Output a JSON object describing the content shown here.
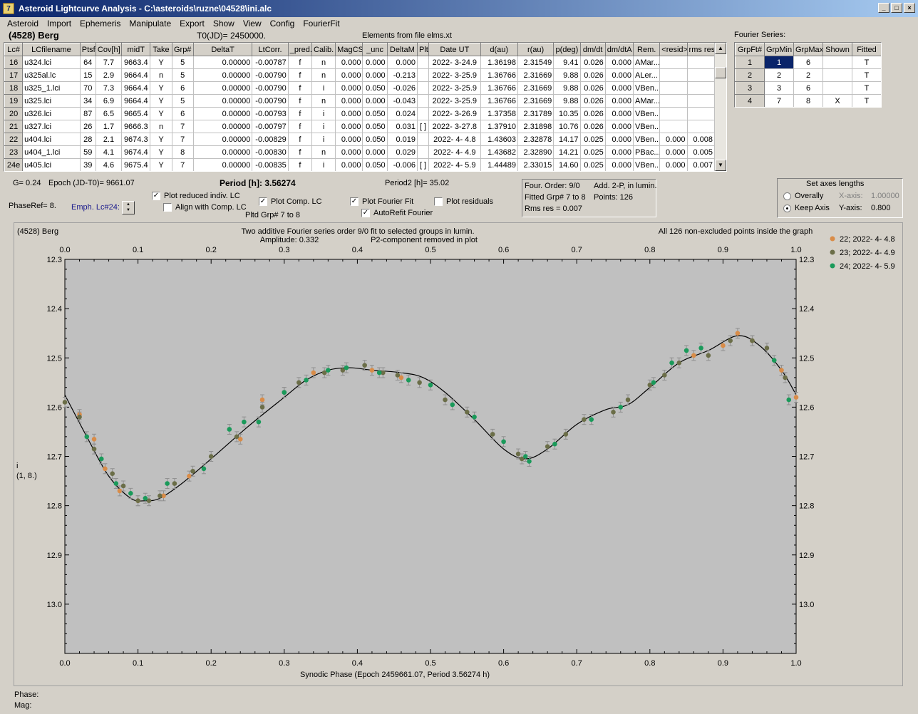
{
  "window": {
    "title": "Asteroid Lightcurve Analysis - C:\\asteroids\\ruzne\\04528\\ini.alc",
    "icon": "app-icon",
    "min": "_",
    "max": "□",
    "close": "×"
  },
  "menu": [
    "Asteroid",
    "Import",
    "Ephemeris",
    "Manipulate",
    "Export",
    "Show",
    "View",
    "Config",
    "FourierFit"
  ],
  "header": {
    "asteroid": "(4528) Berg",
    "t0": "T0(JD)= 2450000.",
    "elements": "Elements from file elms.xt"
  },
  "table": {
    "columns": [
      "Lc#",
      "LCfilename",
      "Ptsf",
      "Cov[h]",
      "midT",
      "Take",
      "Grp#",
      "DeltaT",
      "LtCorr.",
      "_pred.",
      "Calib.",
      "MagCS",
      "_unc",
      "DeltaM",
      "Plt",
      "Date UT",
      "d(au)",
      "r(au)",
      "p(deg)",
      "dm/dt",
      "dm/dtA",
      "Rem.",
      "<resid>",
      "rms res"
    ],
    "rows": [
      [
        "16",
        "u324.lci",
        "64",
        "7.7",
        "9663.4",
        "Y",
        "5",
        "0.00000",
        "-0.00787",
        "f",
        "n",
        "0.000",
        "0.000",
        "0.000",
        "",
        "2022- 3-24.9",
        "1.36198",
        "2.31549",
        "9.41",
        "0.026",
        "0.000",
        "AMar...",
        "",
        ""
      ],
      [
        "17",
        "u325al.lc",
        "15",
        "2.9",
        "9664.4",
        "n",
        "5",
        "0.00000",
        "-0.00790",
        "f",
        "n",
        "0.000",
        "0.000",
        "-0.213",
        "",
        "2022- 3-25.9",
        "1.36766",
        "2.31669",
        "9.88",
        "0.026",
        "0.000",
        "ALer...",
        "",
        ""
      ],
      [
        "18",
        "u325_1.lci",
        "70",
        "7.3",
        "9664.4",
        "Y",
        "6",
        "0.00000",
        "-0.00790",
        "f",
        "i",
        "0.000",
        "0.050",
        "-0.026",
        "",
        "2022- 3-25.9",
        "1.36766",
        "2.31669",
        "9.88",
        "0.026",
        "0.000",
        "VBen...",
        "",
        ""
      ],
      [
        "19",
        "u325.lci",
        "34",
        "6.9",
        "9664.4",
        "Y",
        "5",
        "0.00000",
        "-0.00790",
        "f",
        "n",
        "0.000",
        "0.000",
        "-0.043",
        "",
        "2022- 3-25.9",
        "1.36766",
        "2.31669",
        "9.88",
        "0.026",
        "0.000",
        "AMar...",
        "",
        ""
      ],
      [
        "20",
        "u326.lci",
        "87",
        "6.5",
        "9665.4",
        "Y",
        "6",
        "0.00000",
        "-0.00793",
        "f",
        "i",
        "0.000",
        "0.050",
        "0.024",
        "",
        "2022- 3-26.9",
        "1.37358",
        "2.31789",
        "10.35",
        "0.026",
        "0.000",
        "VBen...",
        "",
        ""
      ],
      [
        "21",
        "u327.lci",
        "26",
        "1.7",
        "9666.3",
        "n",
        "7",
        "0.00000",
        "-0.00797",
        "f",
        "i",
        "0.000",
        "0.050",
        "0.031",
        "[ ]",
        "2022- 3-27.8",
        "1.37910",
        "2.31898",
        "10.76",
        "0.026",
        "0.000",
        "VBen...",
        "",
        ""
      ],
      [
        "22",
        "u404.lci",
        "28",
        "2.1",
        "9674.3",
        "Y",
        "7",
        "0.00000",
        "-0.00829",
        "f",
        "i",
        "0.000",
        "0.050",
        "0.019",
        "",
        "2022- 4- 4.8",
        "1.43603",
        "2.32878",
        "14.17",
        "0.025",
        "0.000",
        "VBen...",
        "0.000",
        "0.008"
      ],
      [
        "23",
        "u404_1.lci",
        "59",
        "4.1",
        "9674.4",
        "Y",
        "8",
        "0.00000",
        "-0.00830",
        "f",
        "n",
        "0.000",
        "0.000",
        "0.029",
        "",
        "2022- 4- 4.9",
        "1.43682",
        "2.32890",
        "14.21",
        "0.025",
        "0.000",
        "PBac...",
        "0.000",
        "0.005"
      ],
      [
        "24e",
        "u405.lci",
        "39",
        "4.6",
        "9675.4",
        "Y",
        "7",
        "0.00000",
        "-0.00835",
        "f",
        "i",
        "0.000",
        "0.050",
        "-0.006",
        "[ ]",
        "2022- 4- 5.9",
        "1.44489",
        "2.33015",
        "14.60",
        "0.025",
        "0.000",
        "VBen...",
        "0.000",
        "0.007"
      ]
    ]
  },
  "fourier": {
    "title": "Fourier Series:",
    "columns": [
      "GrpFt#",
      "GrpMin",
      "GrpMax",
      "Shown",
      "Fitted"
    ],
    "rows": [
      [
        "1",
        "1",
        "6",
        "",
        "T"
      ],
      [
        "2",
        "2",
        "2",
        "",
        "T"
      ],
      [
        "3",
        "3",
        "6",
        "",
        "T"
      ],
      [
        "4",
        "7",
        "8",
        "X",
        "T"
      ]
    ]
  },
  "info": {
    "g": "G= 0.24",
    "epoch": "Epoch (JD-T0)= 9661.07",
    "period": "Period [h]: 3.56274",
    "period2": "Period2 [h]= 35.02",
    "phaseref": "PhaseRef= 8.",
    "emph": "Emph. Lc#24:"
  },
  "checks": {
    "reduced": "Plot reduced indiv. LC",
    "align": "Align with Comp. LC",
    "comp": "Plot Comp. LC",
    "pltd": "Pltd Grp#  7  to   8",
    "fourier": "Plot Fourier Fit",
    "autorefit": "AutoRefit Fourier",
    "residuals": "Plot residuals"
  },
  "fitbox": {
    "order": "Four. Order:  9/0",
    "add": "Add. 2-P, in lumin.",
    "fitted": "Fitted Grp# 7 to 8",
    "points": "Points: 126",
    "rms": "Rms res      = 0.007"
  },
  "axes": {
    "title": "Set axes lengths",
    "overally": "Overally",
    "keep": "Keep Axis",
    "xaxis": "X-axis:",
    "xval": "1.00000",
    "yaxis": "Y-axis:",
    "yval": "0.800"
  },
  "chart_data": {
    "type": "scatter",
    "object": "(4528) Berg",
    "title": "Two additive Fourier series order 9/0 fit to selected groups in lumin.",
    "subtitle": "Amplitude: 0.332",
    "note2": "P2-component removed in plot",
    "note3": "All 126 non-excluded points inside the graph",
    "xlabel": "Synodic Phase (Epoch 2459661.07, Period 3.56274 h)",
    "ylabel": "i",
    "ylabel2": "(1, 8.)",
    "xlim": [
      0,
      1
    ],
    "ylim": [
      12.3,
      13.1
    ],
    "xticks": [
      "0.0",
      "0.1",
      "0.2",
      "0.3",
      "0.4",
      "0.5",
      "0.6",
      "0.7",
      "0.8",
      "0.9",
      "1.0"
    ],
    "yticks": [
      "12.3",
      "12.4",
      "12.5",
      "12.6",
      "12.7",
      "12.8",
      "12.9",
      "13.0"
    ],
    "legend": "top-right",
    "series": [
      {
        "name": "22; 2022- 4- 4.8",
        "color": "#d98c48",
        "points": [
          [
            0.02,
            12.615
          ],
          [
            0.04,
            12.665
          ],
          [
            0.055,
            12.725
          ],
          [
            0.075,
            12.77
          ],
          [
            0.1,
            12.79
          ],
          [
            0.135,
            12.78
          ],
          [
            0.17,
            12.74
          ],
          [
            0.24,
            12.665
          ],
          [
            0.27,
            12.585
          ],
          [
            0.34,
            12.53
          ],
          [
            0.42,
            12.525
          ],
          [
            0.46,
            12.54
          ],
          [
            0.86,
            12.495
          ],
          [
            0.9,
            12.475
          ],
          [
            0.92,
            12.45
          ],
          [
            0.94,
            12.465
          ],
          [
            0.98,
            12.525
          ],
          [
            1.0,
            12.58
          ]
        ]
      },
      {
        "name": "23; 2022- 4- 4.9",
        "color": "#6b6e48",
        "points": [
          [
            0.0,
            12.59
          ],
          [
            0.02,
            12.62
          ],
          [
            0.04,
            12.685
          ],
          [
            0.065,
            12.735
          ],
          [
            0.08,
            12.76
          ],
          [
            0.1,
            12.79
          ],
          [
            0.115,
            12.79
          ],
          [
            0.13,
            12.78
          ],
          [
            0.15,
            12.755
          ],
          [
            0.175,
            12.73
          ],
          [
            0.2,
            12.7
          ],
          [
            0.235,
            12.66
          ],
          [
            0.27,
            12.6
          ],
          [
            0.3,
            12.57
          ],
          [
            0.32,
            12.55
          ],
          [
            0.355,
            12.53
          ],
          [
            0.38,
            12.525
          ],
          [
            0.41,
            12.515
          ],
          [
            0.435,
            12.53
          ],
          [
            0.455,
            12.535
          ],
          [
            0.485,
            12.55
          ],
          [
            0.52,
            12.585
          ],
          [
            0.55,
            12.61
          ],
          [
            0.585,
            12.655
          ],
          [
            0.62,
            12.695
          ],
          [
            0.625,
            12.705
          ],
          [
            0.66,
            12.68
          ],
          [
            0.685,
            12.655
          ],
          [
            0.71,
            12.625
          ],
          [
            0.75,
            12.61
          ],
          [
            0.77,
            12.585
          ],
          [
            0.8,
            12.555
          ],
          [
            0.82,
            12.535
          ],
          [
            0.84,
            12.51
          ],
          [
            0.88,
            12.495
          ],
          [
            0.91,
            12.465
          ],
          [
            0.94,
            12.465
          ],
          [
            0.96,
            12.48
          ],
          [
            0.985,
            12.54
          ]
        ]
      },
      {
        "name": "24; 2022- 4- 5.9",
        "color": "#1a9a5a",
        "points": [
          [
            0.03,
            12.66
          ],
          [
            0.05,
            12.705
          ],
          [
            0.07,
            12.755
          ],
          [
            0.09,
            12.775
          ],
          [
            0.11,
            12.785
          ],
          [
            0.14,
            12.755
          ],
          [
            0.19,
            12.725
          ],
          [
            0.225,
            12.645
          ],
          [
            0.245,
            12.63
          ],
          [
            0.265,
            12.63
          ],
          [
            0.3,
            12.57
          ],
          [
            0.33,
            12.545
          ],
          [
            0.36,
            12.525
          ],
          [
            0.385,
            12.52
          ],
          [
            0.43,
            12.53
          ],
          [
            0.47,
            12.545
          ],
          [
            0.5,
            12.555
          ],
          [
            0.53,
            12.595
          ],
          [
            0.56,
            12.62
          ],
          [
            0.6,
            12.67
          ],
          [
            0.63,
            12.7
          ],
          [
            0.635,
            12.71
          ],
          [
            0.67,
            12.675
          ],
          [
            0.72,
            12.625
          ],
          [
            0.76,
            12.6
          ],
          [
            0.805,
            12.55
          ],
          [
            0.83,
            12.51
          ],
          [
            0.85,
            12.485
          ],
          [
            0.87,
            12.48
          ],
          [
            0.97,
            12.505
          ],
          [
            0.99,
            12.585
          ]
        ]
      }
    ]
  }
}
